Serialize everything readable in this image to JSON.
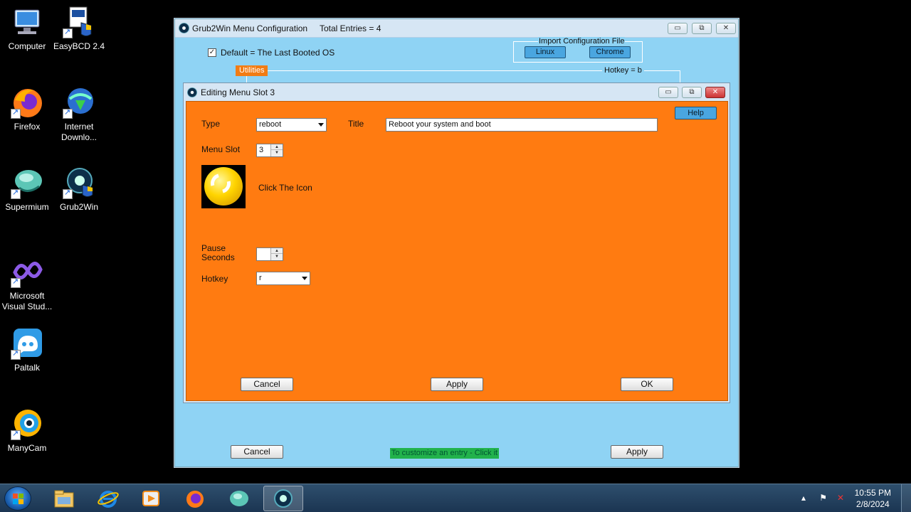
{
  "desktop": {
    "icons": [
      {
        "label": "Computer",
        "icon": "computer-icon"
      },
      {
        "label": "EasyBCD 2.4",
        "icon": "easybcd-icon"
      },
      {
        "label": "Firefox",
        "icon": "firefox-icon"
      },
      {
        "label": "Internet Downlo...",
        "icon": "idm-icon"
      },
      {
        "label": "Supermium",
        "icon": "supermium-icon"
      },
      {
        "label": "Grub2Win",
        "icon": "grub2win-icon"
      },
      {
        "label": "Microsoft Visual Stud...",
        "icon": "visual-studio-icon"
      },
      {
        "label": "Paltalk",
        "icon": "paltalk-icon"
      },
      {
        "label": "ManyCam",
        "icon": "manycam-icon"
      }
    ]
  },
  "main_window": {
    "title": "Grub2Win Menu Configuration",
    "total_entries": "Total Entries = 4",
    "default_checkbox_label": "Default = The Last Booted OS",
    "import_label": "Import Configuration File",
    "import_linux": "Linux",
    "import_chrome": "Chrome",
    "utilities_tag": "Utilities",
    "hotkey_b": "Hotkey = b",
    "cancel": "Cancel",
    "apply": "Apply",
    "status": "To customize an entry - Click it",
    "min_glyph": "▭",
    "max_glyph": "⧉",
    "close_glyph": "✕"
  },
  "dialog": {
    "title": "Editing Menu Slot 3",
    "help": "Help",
    "type_label": "Type",
    "type_value": "reboot",
    "title_label": "Title",
    "title_value": "Reboot your system and boot",
    "menu_slot_label": "Menu Slot",
    "menu_slot_value": "3",
    "click_icon": "Click The Icon",
    "pause_label_1": "Pause",
    "pause_label_2": "Seconds",
    "pause_value": "",
    "hotkey_label": "Hotkey",
    "hotkey_value": "r",
    "cancel": "Cancel",
    "apply": "Apply",
    "ok": "OK"
  },
  "taskbar": {
    "time": "10:55 PM",
    "date": "2/8/2024",
    "items": [
      "file-explorer-icon",
      "internet-explorer-icon",
      "media-player-icon",
      "firefox-icon",
      "supermium-icon",
      "grub2win-icon"
    ]
  }
}
